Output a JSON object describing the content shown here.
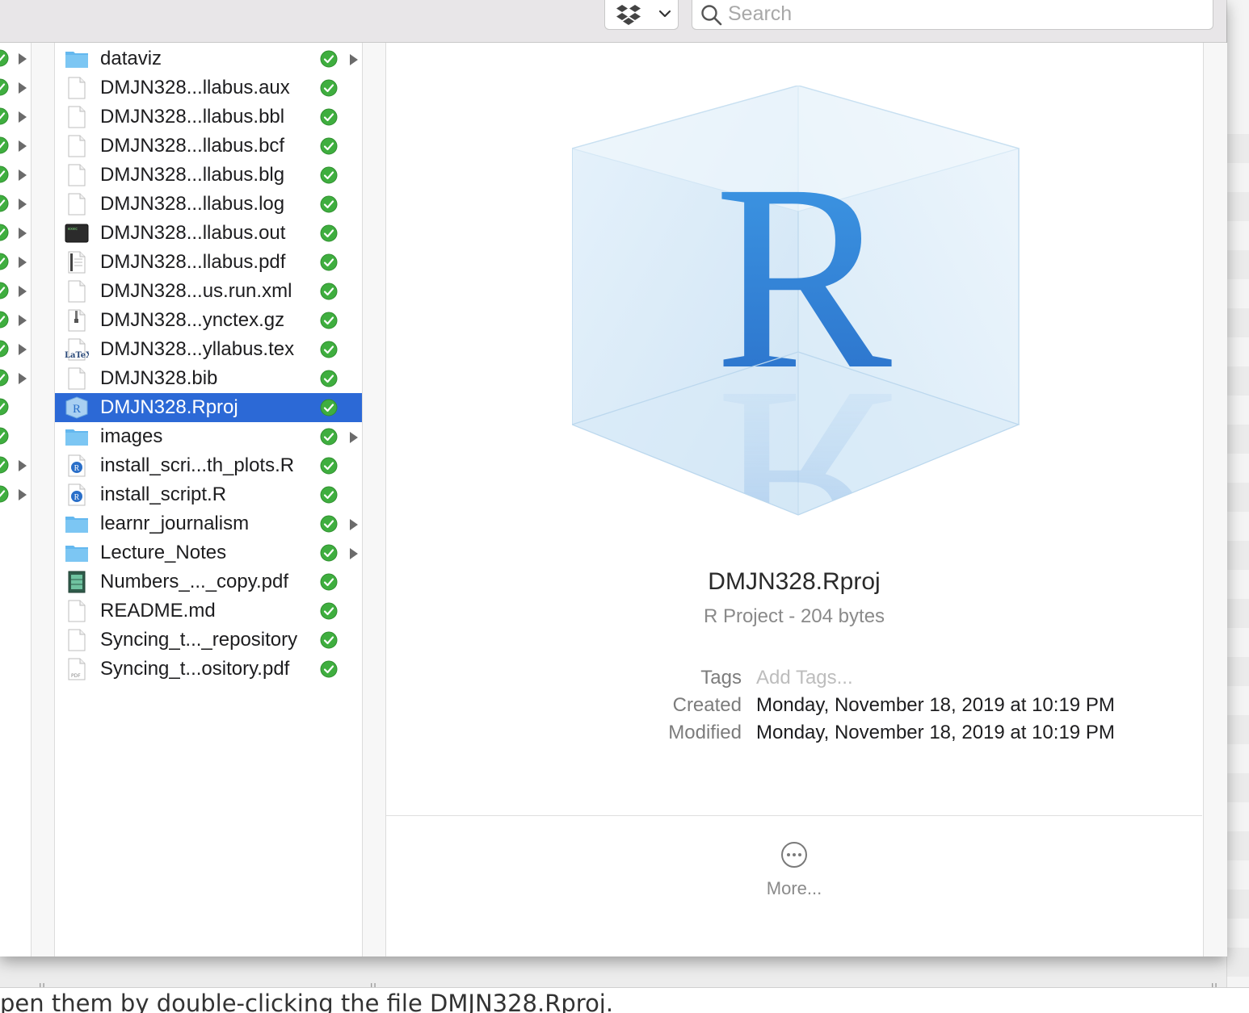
{
  "toolbar": {
    "dropbox_icon": "dropbox-icon",
    "search_placeholder": "Search"
  },
  "left_column": {
    "rows": [
      {
        "synced": true,
        "has_children": true
      },
      {
        "synced": true,
        "has_children": true
      },
      {
        "synced": true,
        "has_children": true
      },
      {
        "synced": true,
        "has_children": true
      },
      {
        "synced": true,
        "has_children": true
      },
      {
        "synced": true,
        "has_children": true
      },
      {
        "synced": true,
        "has_children": true
      },
      {
        "synced": true,
        "has_children": true
      },
      {
        "synced": true,
        "has_children": true
      },
      {
        "synced": true,
        "has_children": true
      },
      {
        "synced": true,
        "has_children": true
      },
      {
        "synced": true,
        "has_children": true
      },
      {
        "synced": true,
        "has_children": false
      },
      {
        "synced": true,
        "has_children": false
      },
      {
        "synced": true,
        "has_children": true
      },
      {
        "synced": true,
        "has_children": true
      }
    ]
  },
  "files": [
    {
      "name": "dataviz",
      "icon": "folder-icon",
      "folder": true,
      "selected": false
    },
    {
      "name": "DMJN328...llabus.aux",
      "icon": "document-icon",
      "folder": false,
      "selected": false
    },
    {
      "name": "DMJN328...llabus.bbl",
      "icon": "document-icon",
      "folder": false,
      "selected": false
    },
    {
      "name": "DMJN328...llabus.bcf",
      "icon": "document-icon",
      "folder": false,
      "selected": false
    },
    {
      "name": "DMJN328...llabus.blg",
      "icon": "document-icon",
      "folder": false,
      "selected": false
    },
    {
      "name": "DMJN328...llabus.log",
      "icon": "document-icon",
      "folder": false,
      "selected": false
    },
    {
      "name": "DMJN328...llabus.out",
      "icon": "terminal-icon",
      "folder": false,
      "selected": false
    },
    {
      "name": "DMJN328...llabus.pdf",
      "icon": "pdf-document-icon",
      "folder": false,
      "selected": false
    },
    {
      "name": "DMJN328...us.run.xml",
      "icon": "document-icon",
      "folder": false,
      "selected": false
    },
    {
      "name": "DMJN328...ynctex.gz",
      "icon": "archive-icon",
      "folder": false,
      "selected": false
    },
    {
      "name": "DMJN328...yllabus.tex",
      "icon": "latex-icon",
      "folder": false,
      "selected": false
    },
    {
      "name": "DMJN328.bib",
      "icon": "document-icon",
      "folder": false,
      "selected": false
    },
    {
      "name": "DMJN328.Rproj",
      "icon": "rproj-icon",
      "folder": false,
      "selected": true
    },
    {
      "name": "images",
      "icon": "folder-icon",
      "folder": true,
      "selected": false
    },
    {
      "name": "install_scri...th_plots.R",
      "icon": "r-script-icon",
      "folder": false,
      "selected": false
    },
    {
      "name": "install_script.R",
      "icon": "r-script-icon",
      "folder": false,
      "selected": false
    },
    {
      "name": "learnr_journalism",
      "icon": "folder-icon",
      "folder": true,
      "selected": false
    },
    {
      "name": "Lecture_Notes",
      "icon": "folder-icon",
      "folder": true,
      "selected": false
    },
    {
      "name": "Numbers_..._copy.pdf",
      "icon": "spreadsheet-pdf-icon",
      "folder": false,
      "selected": false
    },
    {
      "name": "README.md",
      "icon": "document-icon",
      "folder": false,
      "selected": false
    },
    {
      "name": "Syncing_t..._repository",
      "icon": "document-icon",
      "folder": false,
      "selected": false
    },
    {
      "name": "Syncing_t...ository.pdf",
      "icon": "pdf-icon",
      "folder": false,
      "selected": false
    }
  ],
  "preview": {
    "icon": "r-project-cube-icon",
    "name": "DMJN328.Rproj",
    "kind": "R Project - 204 bytes",
    "tags_label": "Tags",
    "tags_placeholder": "Add Tags...",
    "created_label": "Created",
    "created_value": "Monday, November 18, 2019 at 10:19 PM",
    "modified_label": "Modified",
    "modified_value": "Monday, November 18, 2019 at 10:19 PM",
    "more_label": "More..."
  },
  "page_text": "pen them by double-clicking the file DMJN328.Rproj.",
  "colors": {
    "selection": "#2c69d6",
    "sync_green": "#3fae3f",
    "folder_blue": "#64b8ef"
  }
}
